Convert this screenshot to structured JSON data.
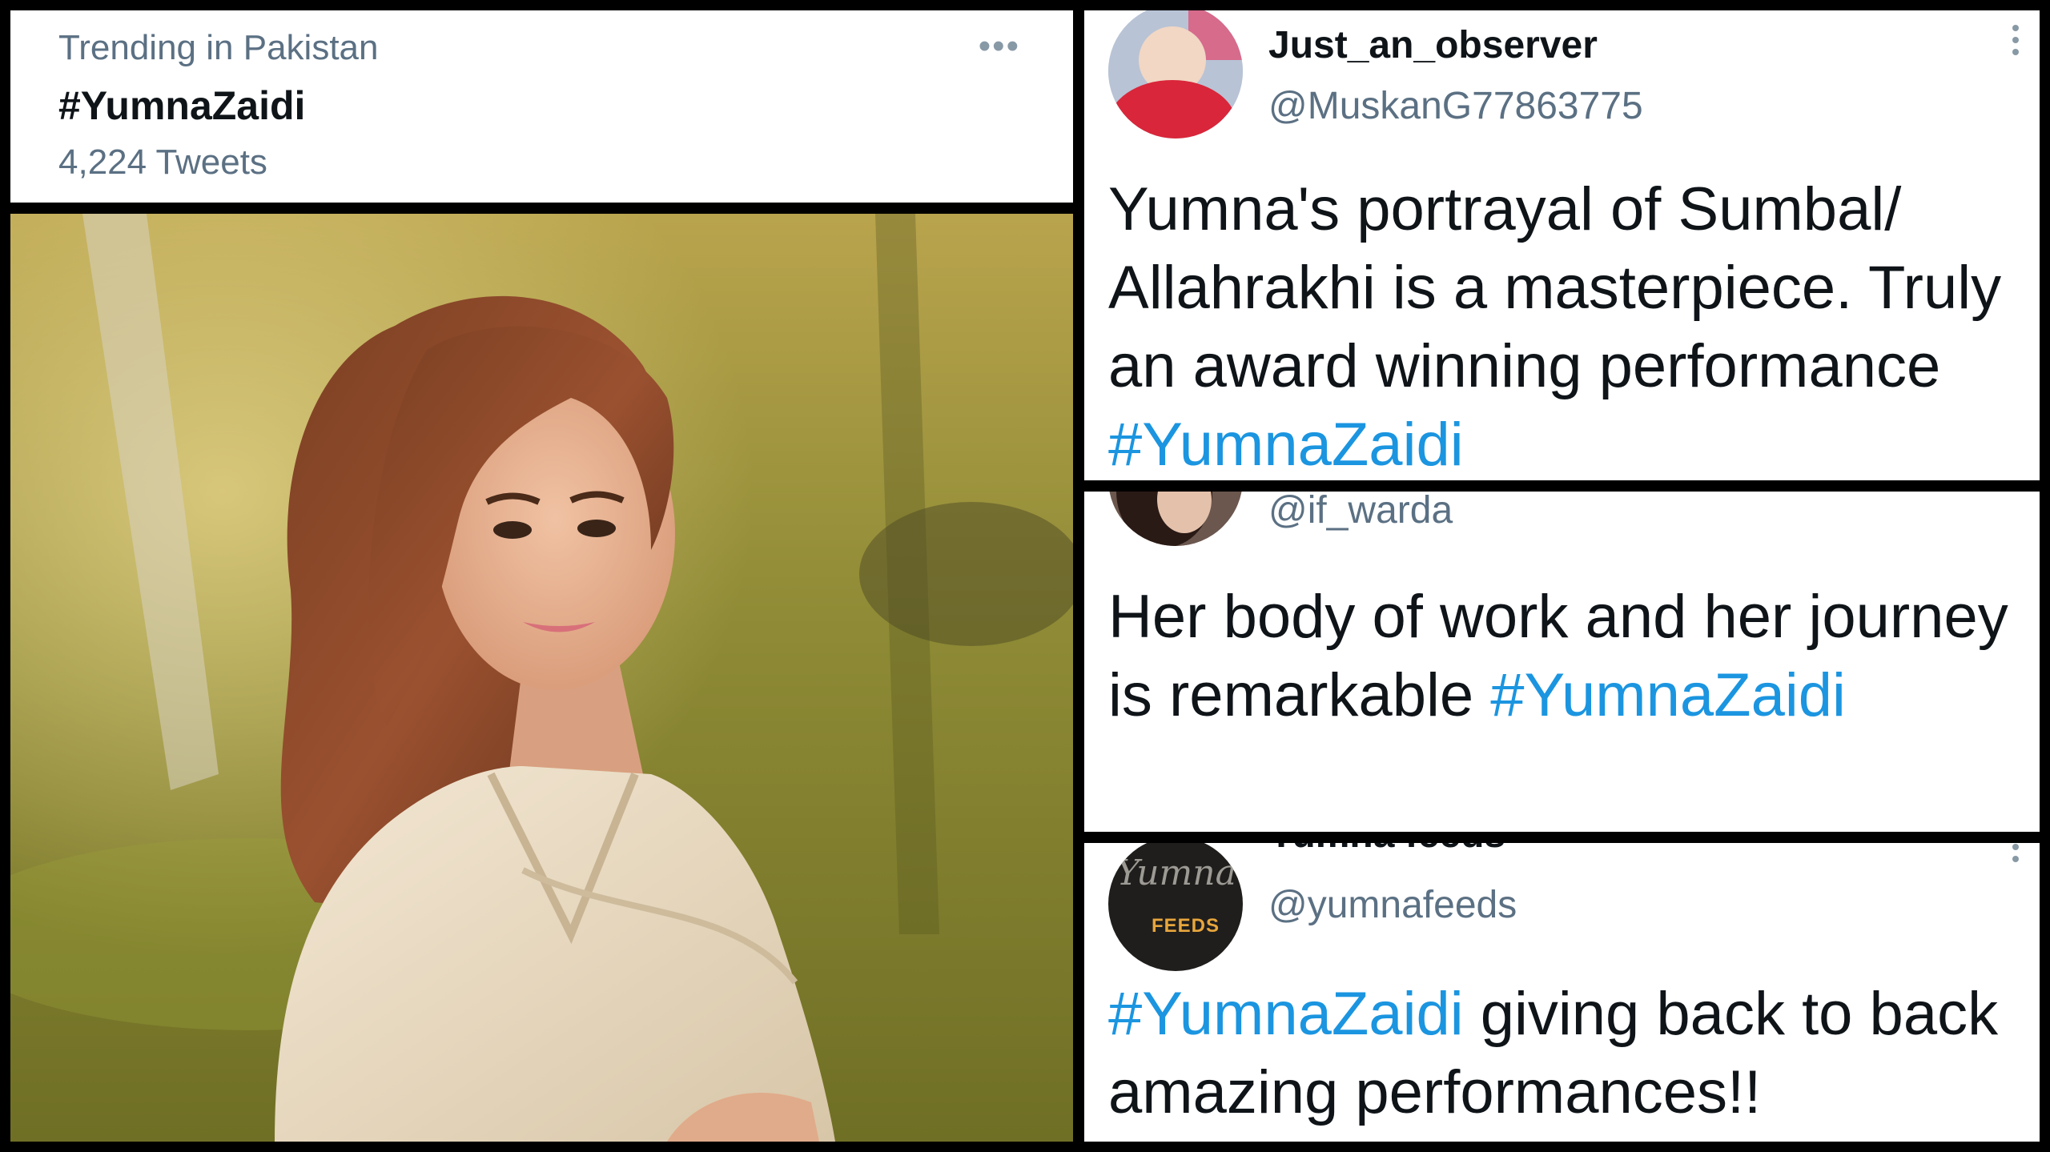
{
  "trend": {
    "context": "Trending in Pakistan",
    "hashtag": "#YumnaZaidi",
    "tweet_count": "4,224 Tweets",
    "more_icon": "more-horizontal-icon"
  },
  "photo": {
    "subject": "woman-portrait-photo"
  },
  "tweets": [
    {
      "display_name": "Just_an_observer",
      "handle": "@MuskanG77863775",
      "text": "Yumna's portrayal of Sumbal/ Allahrakhi is a masterpiece. Truly an award winning performance ",
      "hashtag": "#YumnaZaidi"
    },
    {
      "handle": "@if_warda",
      "text": "Her body of work and her journey is remarkable ",
      "hashtag": "#YumnaZaidi"
    },
    {
      "display_name": "Yumna feeds",
      "handle": "@yumnafeeds",
      "hashtag": "#YumnaZaidi",
      "text": " giving back to back amazing performances!!",
      "avatar_logo_script": "Yumna",
      "avatar_logo_word": "FEEDS"
    }
  ],
  "colors": {
    "background": "#000000",
    "card": "#ffffff",
    "hashtag": "#1b95e0",
    "secondary_text": "#5b7083",
    "primary_text": "#0f1419"
  }
}
